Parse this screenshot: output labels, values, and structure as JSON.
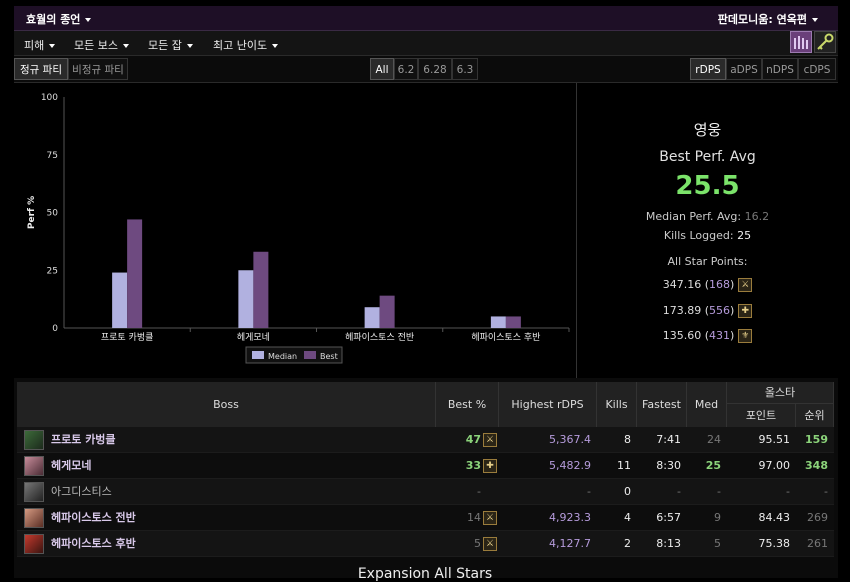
{
  "header": {
    "title": "효월의 종언",
    "character": "판데모니움: 연옥편"
  },
  "menu": {
    "items": [
      "피해",
      "모든 보스",
      "모든 잡",
      "최고 난이도"
    ]
  },
  "filters": {
    "party_tabs": [
      "정규 파티",
      "비정규 파티"
    ],
    "patch_tabs": [
      "All",
      "6.2",
      "6.28",
      "6.3"
    ],
    "metric_tabs": [
      "rDPS",
      "aDPS",
      "nDPS",
      "cDPS"
    ]
  },
  "chart_data": {
    "type": "bar",
    "categories": [
      "프로토 카벙클",
      "헤게모네",
      "헤파이스토스 전반",
      "헤파이스토스 후반"
    ],
    "series": [
      {
        "name": "Median",
        "values": [
          24,
          25,
          9,
          5
        ]
      },
      {
        "name": "Best",
        "values": [
          47,
          33,
          14,
          5
        ]
      }
    ],
    "ylabel": "Perf %",
    "ylim": [
      0,
      100
    ],
    "yticks": [
      "0",
      "25",
      "50",
      "75",
      "100"
    ],
    "colors": {
      "Median": "#b1b1e0",
      "Best": "#6e4a80"
    },
    "legend": "bottom-center"
  },
  "stats": {
    "job": "영웅",
    "best_perf_label": "Best Perf. Avg",
    "best_perf_value": "25.5",
    "median_label": "Median Perf. Avg:",
    "median_value": "16.2",
    "kills_label": "Kills Logged:",
    "kills_value": "25",
    "allstar_label": "All Star Points:",
    "allstars": [
      {
        "points": "347.16",
        "rank": "168",
        "icon": "crossed-swords-icon"
      },
      {
        "points": "173.89",
        "rank": "556",
        "icon": "healer-icon"
      },
      {
        "points": "135.60",
        "rank": "431",
        "icon": "fleur-icon"
      }
    ]
  },
  "table": {
    "headers": {
      "boss": "Boss",
      "best": "Best %",
      "highest": "Highest rDPS",
      "kills": "Kills",
      "fastest": "Fastest",
      "med": "Med",
      "allstar": "올스타",
      "points": "포인트",
      "rank": "순위"
    },
    "rows": [
      {
        "boss": "프로토 카벙클",
        "best": "47",
        "highest": "5,367.4",
        "kills": "8",
        "fastest": "7:41",
        "med": "24",
        "points": "95.51",
        "rank": "159"
      },
      {
        "boss": "헤게모네",
        "best": "33",
        "highest": "5,482.9",
        "kills": "11",
        "fastest": "8:30",
        "med": "25",
        "points": "97.00",
        "rank": "348"
      },
      {
        "boss": "아그디스티스",
        "best": "-",
        "highest": "-",
        "kills": "0",
        "fastest": "-",
        "med": "-",
        "points": "-",
        "rank": "-"
      },
      {
        "boss": "헤파이스토스 전반",
        "best": "14",
        "highest": "4,923.3",
        "kills": "4",
        "fastest": "6:57",
        "med": "9",
        "points": "84.43",
        "rank": "269"
      },
      {
        "boss": "헤파이스토스 후반",
        "best": "5",
        "highest": "4,127.7",
        "kills": "2",
        "fastest": "8:13",
        "med": "5",
        "points": "75.38",
        "rank": "261"
      }
    ]
  },
  "footer": {
    "title": "Expansion All Stars"
  }
}
